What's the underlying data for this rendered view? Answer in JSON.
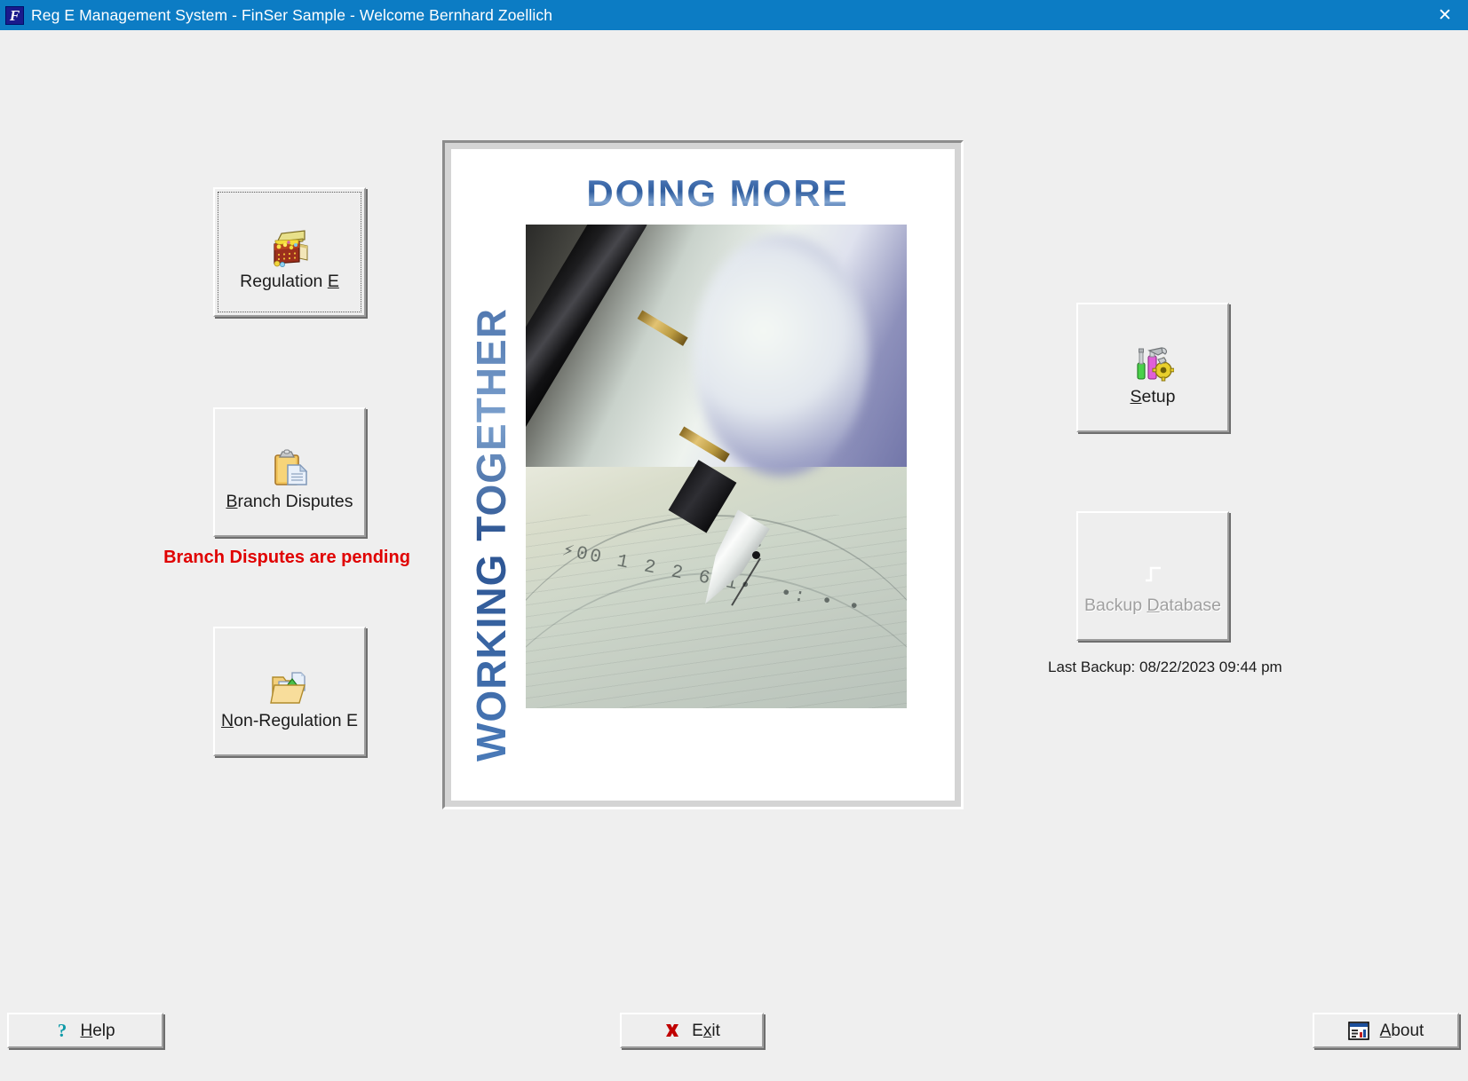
{
  "window": {
    "title": "Reg E Management System - FinSer Sample - Welcome Bernhard Zoellich",
    "app_icon": "finser-f-logo-icon",
    "close_label": "✕",
    "titlebar_color": "#0c7cc4",
    "body_color": "#efefef"
  },
  "left_nav": {
    "buttons": [
      {
        "label": "Regulation E",
        "accel": "E",
        "icon": "treasure-chest-icon",
        "focused": true,
        "enabled": true
      },
      {
        "label": "Branch Disputes",
        "accel": "B",
        "icon": "clipboard-document-icon",
        "focused": false,
        "enabled": true
      },
      {
        "label": "Non-Regulation E",
        "accel": "N",
        "icon": "folder-move-icon",
        "focused": false,
        "enabled": true
      }
    ],
    "pending_message": "Branch Disputes are pending",
    "pending_color": "#e00000"
  },
  "right_nav": {
    "buttons": [
      {
        "label": "Setup",
        "accel": "S",
        "icon": "tools-gear-icon",
        "enabled": true
      },
      {
        "label": "Backup Database",
        "accel": "D",
        "icon": "backup-database-icon",
        "enabled": false
      }
    ],
    "last_backup": "Last Backup: 08/22/2023 09:44 pm"
  },
  "poster": {
    "headline": "DOING MORE",
    "vertical_text": "WORKING TOGETHER",
    "image_description": "fountain-pen-signing-check-photo",
    "text_color": "#2f5d9e"
  },
  "footer": {
    "help": {
      "label": "Help",
      "accel": "H",
      "icon": "question-mark-icon"
    },
    "exit": {
      "label": "Exit",
      "accel": "x",
      "icon": "red-x-icon"
    },
    "about": {
      "label": "About",
      "accel": "A",
      "icon": "about-window-icon"
    }
  }
}
